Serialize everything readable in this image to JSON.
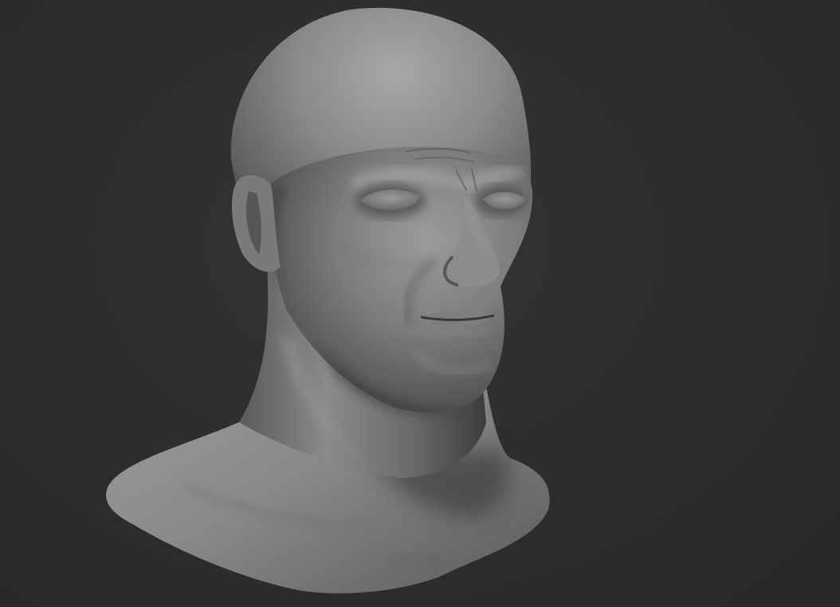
{
  "scene": {
    "subject": "sculpted-head-bust",
    "background_color": "#2c2c2c",
    "material_light": "#9a9a9a",
    "material_mid": "#6e6e6e",
    "material_dark": "#3a3a3a"
  }
}
